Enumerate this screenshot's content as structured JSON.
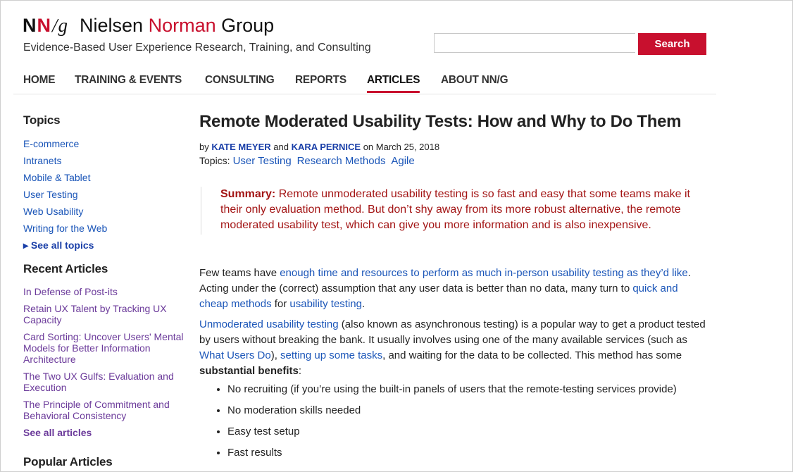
{
  "header": {
    "logo_n1": "N",
    "logo_n2": "N",
    "logo_g": "/g",
    "name_part1": "Nielsen",
    "name_part2": "Norman",
    "name_part3": "Group",
    "tagline": "Evidence-Based User Experience Research, Training, and Consulting",
    "search_value": "",
    "search_button": "Search"
  },
  "nav": {
    "items": [
      "HOME",
      "TRAINING & EVENTS",
      "CONSULTING",
      "REPORTS",
      "ARTICLES",
      "ABOUT NN/G"
    ],
    "active": "ARTICLES"
  },
  "sidebar": {
    "topics_heading": "Topics",
    "topics": [
      "E-commerce",
      "Intranets",
      "Mobile & Tablet",
      "User Testing",
      "Web Usability",
      "Writing for the Web"
    ],
    "see_all_topics": "See all topics",
    "recent_heading": "Recent Articles",
    "recent": [
      "In Defense of Post-its",
      "Retain UX Talent by Tracking UX Capacity",
      "Card Sorting: Uncover Users' Mental Models for Better Information Architecture",
      "The Two UX Gulfs: Evaluation and Execution",
      "The Principle of Commitment and Behavioral Consistency"
    ],
    "see_all_articles": "See all articles",
    "popular_heading": "Popular Articles"
  },
  "article": {
    "title": "Remote Moderated Usability Tests: How and Why to Do Them",
    "by": "by",
    "author1": "KATE MEYER",
    "and": "and",
    "author2": "KARA PERNICE",
    "date": "on March 25, 2018",
    "topics_label": "Topics:",
    "topics": [
      "User Testing",
      "Research Methods",
      "Agile"
    ],
    "summary_label": "Summary:",
    "summary_text": "Remote unmoderated usability testing is so fast and easy that some teams make it their only evaluation method. But don’t shy away from its more robust alternative, the remote moderated usability test, which can give you more information and is also inexpensive.",
    "p1_a": "Few teams have ",
    "p1_link1": "enough time and resources to perform as much in-person usability testing as they’d like",
    "p1_b": ". Acting under the (correct) assumption that any user data is better than no data, many turn to ",
    "p1_link2": "quick and cheap methods",
    "p1_c": " for ",
    "p1_link3": "usability testing",
    "p1_d": ".",
    "p2_link1": "Unmoderated usability testing",
    "p2_a": " (also known as asynchronous testing) is a popular way to get a product tested by users without breaking the bank. It usually involves using one of the many available services (such as ",
    "p2_link2": "What Users Do",
    "p2_b": "), ",
    "p2_link3": "setting up some tasks",
    "p2_c": ", and waiting for the data to be collected. This method has some ",
    "p2_bold": "substantial benefits",
    "p2_d": ":",
    "benefits": [
      "No recruiting (if you’re using the built-in panels of users that the remote-testing services provide)",
      "No moderation skills needed",
      "Easy test setup",
      "Fast results"
    ]
  }
}
